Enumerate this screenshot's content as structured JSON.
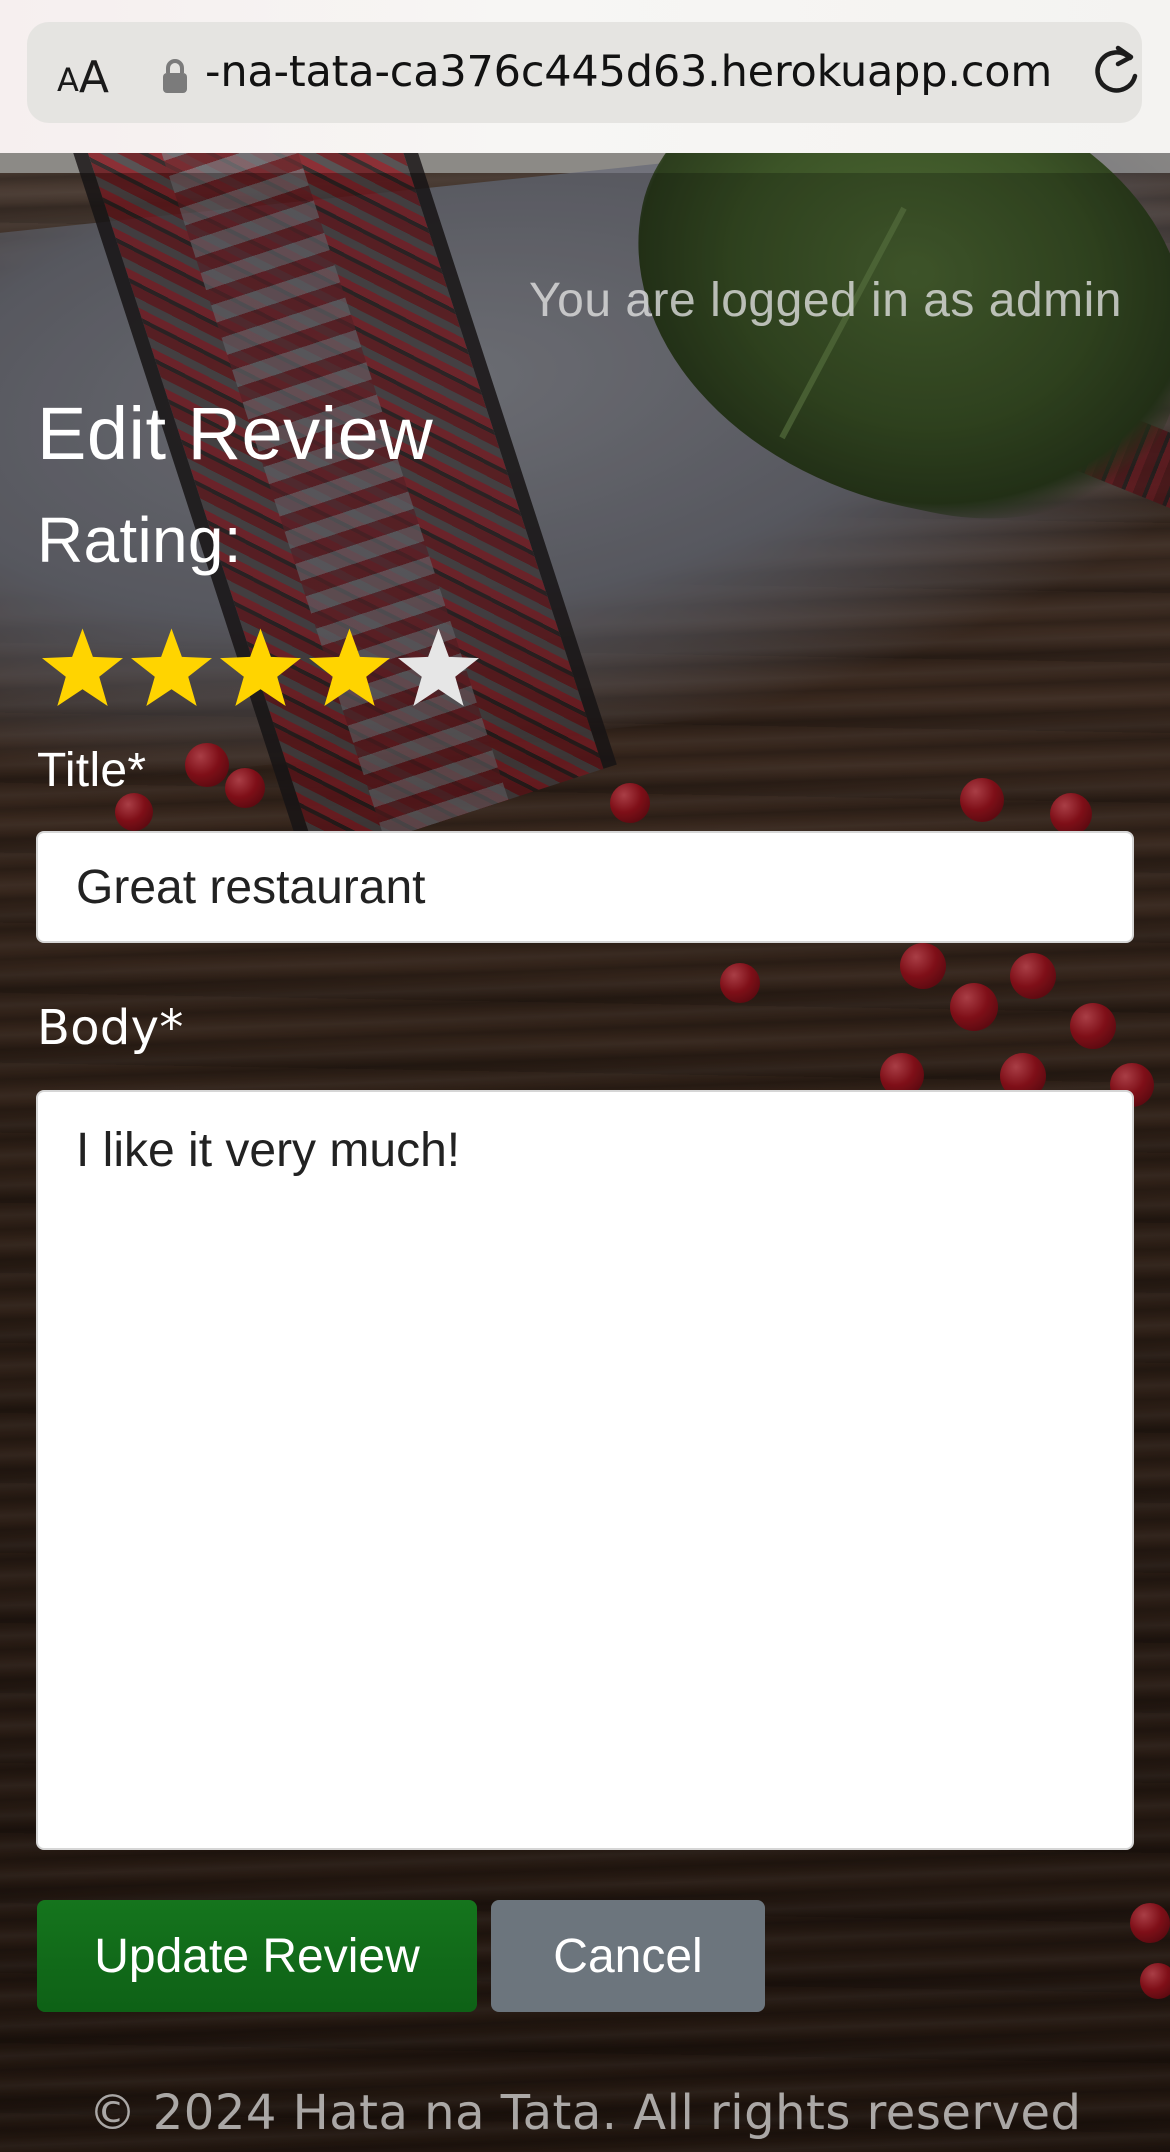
{
  "browser": {
    "text_size_small": "A",
    "text_size_large": "A",
    "url": "-na-tata-ca376c445d63.herokuapp.com"
  },
  "header": {
    "logged_in_text": "You are logged in as admin"
  },
  "form": {
    "page_title": "Edit Review",
    "rating_label": "Rating:",
    "rating": {
      "value": 4,
      "max": 5,
      "filled_color": "#FFD400",
      "empty_color": "#E6E6E6"
    },
    "title_label": "Title*",
    "title_value": "Great restaurant",
    "body_label": "Body*",
    "body_value": "I like it very much!",
    "update_button": "Update Review",
    "cancel_button": "Cancel"
  },
  "footer": {
    "text": "© 2024 Hata na Tata. All rights reserved"
  },
  "colors": {
    "update_button": "#0E6116",
    "cancel_button": "#6C757D",
    "browser_bar": "#F5F4F2",
    "url_pill": "#E5E4E1"
  }
}
